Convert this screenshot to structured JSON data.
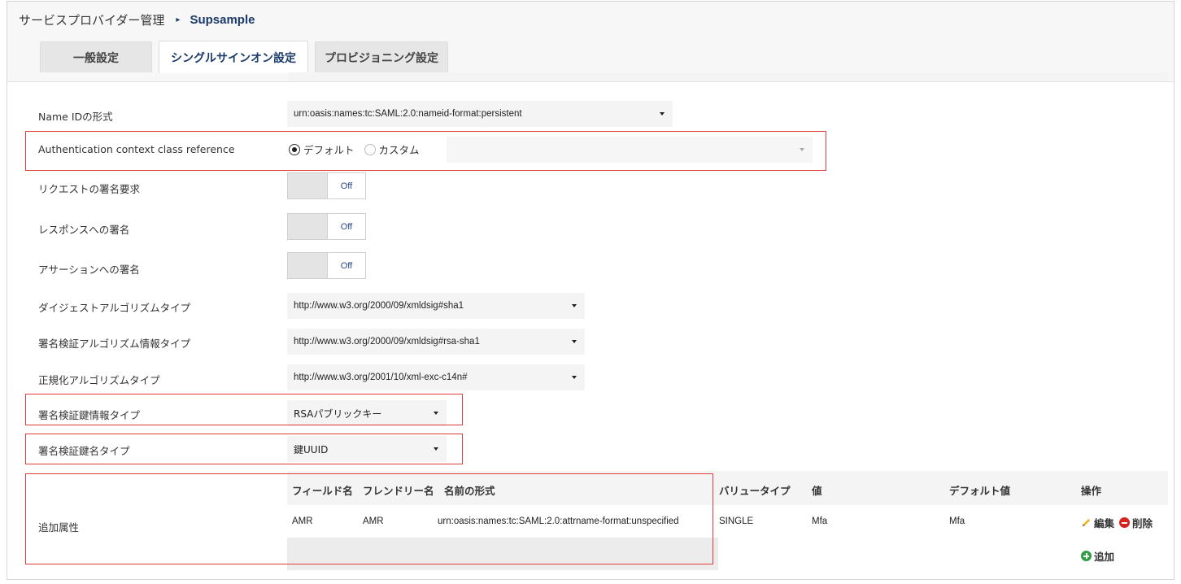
{
  "breadcrumb": {
    "root": "サービスプロバイダー管理",
    "separator": "▸",
    "current": "Supsample"
  },
  "tabs": [
    {
      "label": "一般設定",
      "active": false
    },
    {
      "label": "シングルサインオン設定",
      "active": true
    },
    {
      "label": "プロビジョニング設定",
      "active": false
    }
  ],
  "settings": {
    "name_id": {
      "label": "Name IDの形式",
      "value": "urn:oasis:names:tc:SAML:2.0:nameid-format:persistent"
    },
    "authn_context": {
      "label": "Authentication context class reference",
      "options": [
        "デフォルト",
        "カスタム"
      ],
      "selected": "デフォルト",
      "custom_value": ""
    },
    "request_sign": {
      "label": "リクエストの署名要求",
      "state": "Off"
    },
    "response_sign": {
      "label": "レスポンスへの署名",
      "state": "Off"
    },
    "assertion_sign": {
      "label": "アサーションへの署名",
      "state": "Off"
    },
    "digest_algo": {
      "label": "ダイジェストアルゴリズムタイプ",
      "value": "http://www.w3.org/2000/09/xmldsig#sha1"
    },
    "signature_algo": {
      "label": "署名検証アルゴリズム情報タイプ",
      "value": "http://www.w3.org/2000/09/xmldsig#rsa-sha1"
    },
    "canonical_algo": {
      "label": "正規化アルゴリズムタイプ",
      "value": "http://www.w3.org/2001/10/xml-exc-c14n#"
    },
    "key_info_type": {
      "label": "署名検証鍵情報タイプ",
      "value": "RSAパブリックキー"
    },
    "key_name_type": {
      "label": "署名検証鍵名タイプ",
      "value": "鍵UUID"
    }
  },
  "attributes": {
    "label": "追加属性",
    "headers": {
      "field": "フィールド名",
      "friendly": "フレンドリー名",
      "format": "名前の形式",
      "value_type": "バリュータイプ",
      "value": "値",
      "default": "デフォルト値",
      "ops": "操作"
    },
    "rows": [
      {
        "field": "AMR",
        "friendly": "AMR",
        "format": "urn:oasis:names:tc:SAML:2.0:attrname-format:unspecified",
        "value_type": "SINGLE",
        "value": "Mfa",
        "default": "Mfa"
      }
    ],
    "edit_label": "編集",
    "delete_label": "削除",
    "add_label": "追加"
  },
  "colors": {
    "highlight": "#e03c3c",
    "accent": "#1a3a6b",
    "add": "#2f9e44",
    "delete": "#d6231f"
  },
  "icons": [
    "pencil-icon",
    "delete-icon",
    "add-icon",
    "radio-icon",
    "chevron-down-icon"
  ]
}
